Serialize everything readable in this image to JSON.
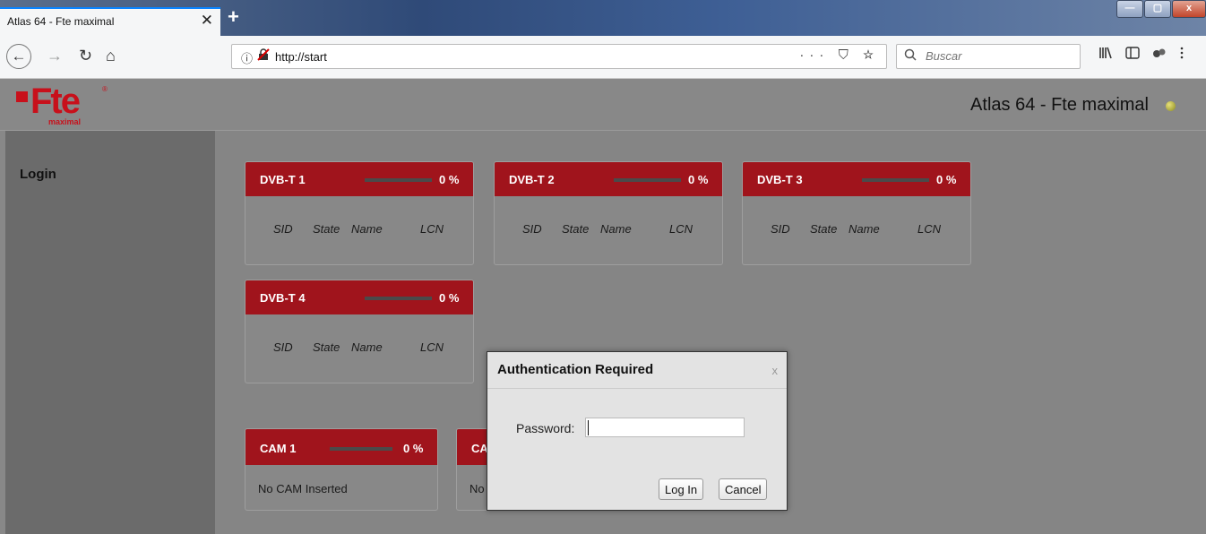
{
  "browser": {
    "tab_title": "Atlas 64 - Fte maximal",
    "tab_close": "✕",
    "new_tab": "+",
    "window_controls": {
      "minimize": "—",
      "maximize": "▢",
      "close": "x"
    },
    "nav": {
      "back": "←",
      "forward": "→",
      "reload": "↻",
      "home": "⌂"
    },
    "url": "http://start",
    "url_info_icon": "ⓘ",
    "url_lock_icon": "🔒",
    "url_actions": "··· ⛉ ☆",
    "search_placeholder": "Buscar",
    "toolbar_icons": [
      "library-icon",
      "sidebar-icon",
      "extension-icon",
      "menu-icon"
    ]
  },
  "header": {
    "logo": {
      "brand": "Fte",
      "reg": "®",
      "sub": "maximal",
      "brand_color": "#c8101b"
    },
    "title": "Atlas 64 - Fte maximal",
    "status_color": "#b5b53a"
  },
  "sidebar": {
    "login": "Login"
  },
  "tuners": [
    {
      "name": "DVB-T 1",
      "percent": "0 %",
      "cols": [
        "SID",
        "State",
        "Name",
        "LCN"
      ]
    },
    {
      "name": "DVB-T 2",
      "percent": "0 %",
      "cols": [
        "SID",
        "State",
        "Name",
        "LCN"
      ]
    },
    {
      "name": "DVB-T 3",
      "percent": "0 %",
      "cols": [
        "SID",
        "State",
        "Name",
        "LCN"
      ]
    },
    {
      "name": "DVB-T 4",
      "percent": "0 %",
      "cols": [
        "SID",
        "State",
        "Name",
        "LCN"
      ]
    }
  ],
  "cams": [
    {
      "name": "CAM 1",
      "percent": "0 %",
      "message": "No CAM Inserted"
    },
    {
      "name": "CA",
      "message": "No"
    }
  ],
  "modal": {
    "title": "Authentication Required",
    "close": "x",
    "password_label": "Password:",
    "password_value": "",
    "login_button": "Log In",
    "cancel_button": "Cancel"
  },
  "colors": {
    "card_header": "#a0141c",
    "page_bg": "#888888",
    "sidebar_bg": "#6b6b6b"
  }
}
